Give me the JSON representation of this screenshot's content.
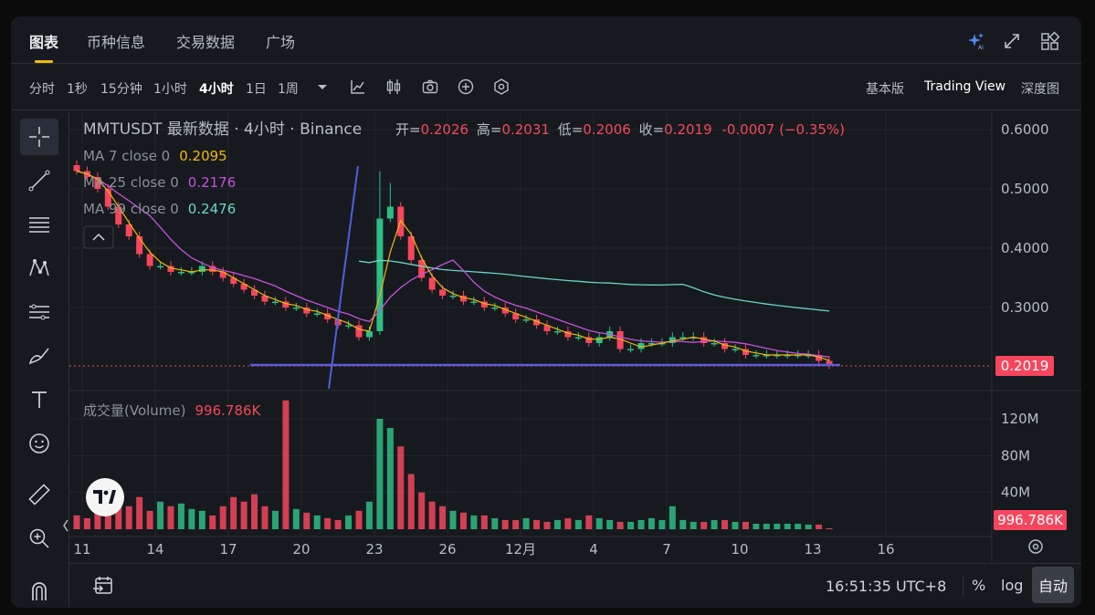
{
  "tabs": [
    {
      "label": "图表"
    },
    {
      "label": "币种信息"
    },
    {
      "label": "交易数据"
    },
    {
      "label": "广场"
    }
  ],
  "timeframes": [
    {
      "label": "分时"
    },
    {
      "label": "1秒"
    },
    {
      "label": "15分钟"
    },
    {
      "label": "1小时"
    },
    {
      "label": "4小时"
    },
    {
      "label": "1日"
    },
    {
      "label": "1周"
    }
  ],
  "views": [
    {
      "label": "基本版"
    },
    {
      "label": "Trading View"
    },
    {
      "label": "深度图"
    }
  ],
  "legend": {
    "title": "MMTUSDT 最新数据 · 4小时 · Binance",
    "open_label": "开=",
    "open": "0.2026",
    "high_label": "高=",
    "high": "0.2031",
    "low_label": "低=",
    "low": "0.2006",
    "close_label": "收=",
    "close": "0.2019",
    "change": "-0.0007 (−0.35%)",
    "ma7_label": "MA 7 close 0",
    "ma7": "0.2095",
    "ma25_label": "MA 25 close 0",
    "ma25": "0.2176",
    "ma99_label": "MA 99 close 0",
    "ma99": "0.2476",
    "volume_label": "成交量(Volume)",
    "volume": "996.786K",
    "collapse_icon": "chevron-up-icon"
  },
  "colors": {
    "up": "#2ebd85",
    "down": "#f6465d",
    "ma7": "#f0b90b",
    "ma25": "#c94fe0",
    "ma99": "#6dd3c8",
    "trendline": "#4b5fe6",
    "accent": "#f0b90b"
  },
  "axis": {
    "price_ticks": [
      "0.6000",
      "0.5000",
      "0.4000",
      "0.3000"
    ],
    "last_price_tag": "0.2019",
    "volume_ticks": [
      "120M",
      "80M",
      "40M"
    ],
    "volume_tag": "996.786K",
    "x_ticks": [
      "11",
      "14",
      "17",
      "20",
      "23",
      "26",
      "12月",
      "4",
      "7",
      "10",
      "13",
      "16"
    ]
  },
  "chart_data": [
    {
      "type": "candlestick",
      "title": "MMTUSDT 最新数据 · 4小时 · Binance",
      "x": [
        "11",
        "14",
        "17",
        "20",
        "23",
        "26",
        "12月",
        "4",
        "7",
        "10",
        "13",
        "16"
      ],
      "ylim": [
        0.17,
        0.63
      ],
      "grid": true,
      "close_series_approx": [
        0.53,
        0.52,
        0.5,
        0.47,
        0.44,
        0.42,
        0.39,
        0.37,
        0.37,
        0.36,
        0.36,
        0.36,
        0.37,
        0.36,
        0.35,
        0.34,
        0.33,
        0.32,
        0.31,
        0.31,
        0.3,
        0.3,
        0.29,
        0.29,
        0.28,
        0.27,
        0.27,
        0.25,
        0.26,
        0.45,
        0.47,
        0.42,
        0.38,
        0.35,
        0.33,
        0.32,
        0.32,
        0.31,
        0.31,
        0.3,
        0.3,
        0.29,
        0.28,
        0.28,
        0.27,
        0.26,
        0.26,
        0.25,
        0.25,
        0.24,
        0.25,
        0.26,
        0.23,
        0.23,
        0.24,
        0.24,
        0.24,
        0.25,
        0.25,
        0.25,
        0.24,
        0.24,
        0.23,
        0.23,
        0.22,
        0.22,
        0.22,
        0.22,
        0.22,
        0.22,
        0.22,
        0.21,
        0.2019
      ],
      "series": [
        {
          "name": "MA 7 close 0",
          "last": 0.2095
        },
        {
          "name": "MA 25 close 0",
          "last": 0.2176
        },
        {
          "name": "MA 99 close 0",
          "last": 0.2476
        }
      ],
      "last_price": 0.2019,
      "high_spike": 0.53,
      "open": 0.2026,
      "high": 0.2031,
      "low": 0.2006,
      "close": 0.2019
    },
    {
      "type": "bar",
      "title": "成交量(Volume)",
      "ylim": [
        0,
        150
      ],
      "ylabel": "",
      "values_approx_M": [
        15,
        12,
        20,
        18,
        30,
        25,
        35,
        20,
        30,
        25,
        28,
        22,
        20,
        15,
        25,
        35,
        30,
        38,
        25,
        20,
        140,
        22,
        18,
        15,
        12,
        10,
        15,
        20,
        30,
        120,
        110,
        90,
        60,
        40,
        30,
        25,
        20,
        18,
        15,
        15,
        12,
        10,
        10,
        12,
        10,
        8,
        10,
        12,
        10,
        15,
        12,
        10,
        8,
        8,
        10,
        12,
        10,
        25,
        10,
        8,
        8,
        10,
        10,
        8,
        8,
        6,
        6,
        6,
        6,
        6,
        5,
        5,
        1
      ],
      "last": "996.786K"
    }
  ],
  "bottom": {
    "clock": "16:51:35 UTC+8",
    "percent": "%",
    "log": "log",
    "auto": "自动"
  }
}
